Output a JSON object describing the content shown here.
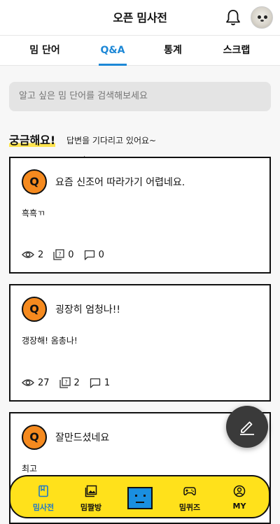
{
  "header": {
    "title": "오픈 밈사전"
  },
  "tabs": [
    {
      "label": "밈 단어",
      "active": false
    },
    {
      "label": "Q&A",
      "active": true
    },
    {
      "label": "통계",
      "active": false
    },
    {
      "label": "스크랩",
      "active": false
    }
  ],
  "search": {
    "placeholder": "알고 싶은 밈 단어를 검색해보세요"
  },
  "section": {
    "title": "궁금해요!",
    "subtitle": "답변을 기다리고 있어요~"
  },
  "questions": [
    {
      "badge": "Q",
      "title": "요즘 신조어 따라가기 어렵네요.",
      "body": "흑흑ㄲ",
      "views": "2",
      "answers": "0",
      "comments": "0"
    },
    {
      "badge": "Q",
      "title": "굉장히 엄청나!!",
      "body": "갱장해! 옴총나!",
      "views": "27",
      "answers": "2",
      "comments": "1"
    },
    {
      "badge": "Q",
      "title": "잘만드셨네요",
      "body": "최고"
    }
  ],
  "bottom_nav": [
    {
      "label": "밈사전",
      "active": true
    },
    {
      "label": "밈짤방",
      "active": false
    },
    {
      "label": "",
      "active": false
    },
    {
      "label": "밈퀴즈",
      "active": false
    },
    {
      "label": "MY",
      "active": false
    }
  ],
  "colors": {
    "accent": "#1e88d6",
    "badge": "#f58a1f",
    "nav_bg": "#ffe11b",
    "fab": "#3a3a3a"
  }
}
